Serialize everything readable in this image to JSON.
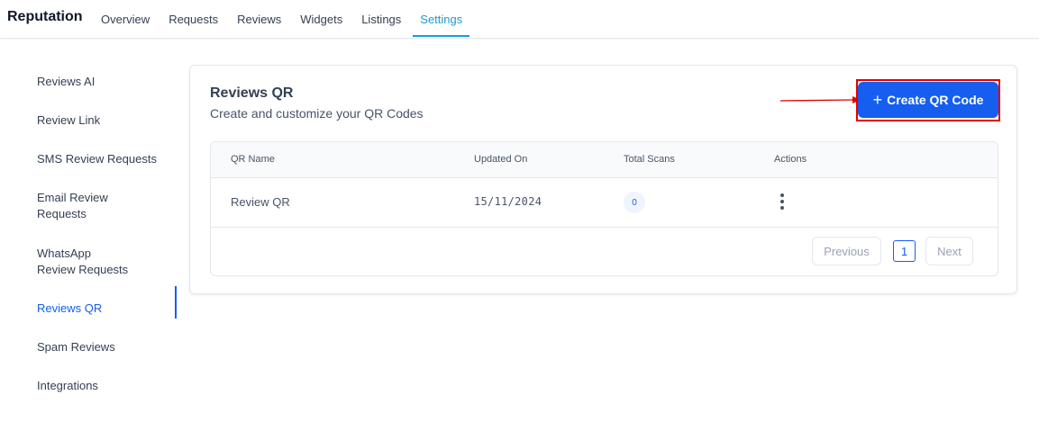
{
  "header": {
    "brand": "Reputation",
    "tabs": [
      {
        "label": "Overview"
      },
      {
        "label": "Requests"
      },
      {
        "label": "Reviews"
      },
      {
        "label": "Widgets"
      },
      {
        "label": "Listings"
      },
      {
        "label": "Settings",
        "active": true
      }
    ]
  },
  "sidebar": {
    "items": [
      {
        "label": "Reviews AI"
      },
      {
        "label": "Review Link"
      },
      {
        "label": "SMS Review Requests"
      },
      {
        "label": "Email Review Requests"
      },
      {
        "label": "WhatsApp Review Requests"
      },
      {
        "label": "Reviews QR",
        "active": true
      },
      {
        "label": "Spam Reviews"
      },
      {
        "label": "Integrations"
      }
    ]
  },
  "main": {
    "title": "Reviews QR",
    "subtitle": "Create and customize your QR Codes",
    "create_button": {
      "icon": "plus-icon",
      "label": "Create QR Code"
    },
    "table": {
      "columns": [
        "QR Name",
        "Updated On",
        "Total Scans",
        "Actions"
      ],
      "rows": [
        {
          "name": "Review QR",
          "updated_on": "15/11/2024",
          "total_scans": "0"
        }
      ]
    },
    "pagination": {
      "previous": "Previous",
      "current_page": "1",
      "next": "Next"
    }
  },
  "colors": {
    "accent": "#155eef",
    "active_tab": "#1d9bd6",
    "annotation": "#e00000"
  }
}
